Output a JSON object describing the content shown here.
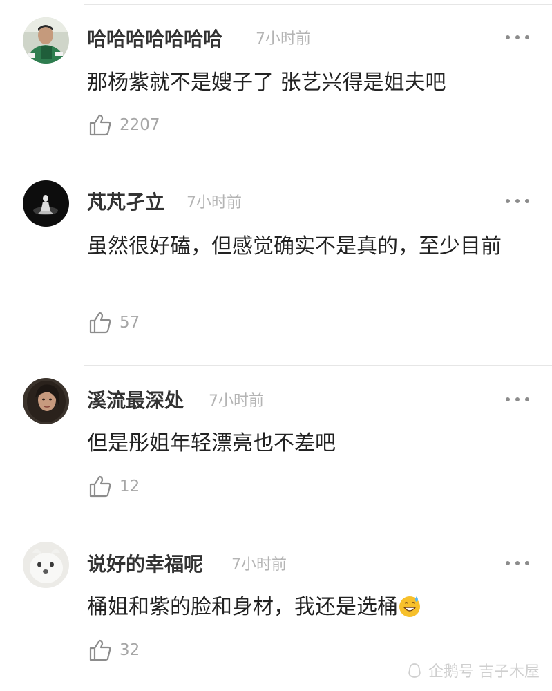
{
  "comments": [
    {
      "username": "哈哈哈哈哈哈哈",
      "time": "7小时前",
      "text": "那杨紫就不是嫂子了 张艺兴得是姐夫吧",
      "likes": "2207"
    },
    {
      "username": "芃芃孑立",
      "time": "7小时前",
      "text": "虽然很好磕，但感觉确实不是真的，至少目前",
      "likes": "57"
    },
    {
      "username": "溪流最深处",
      "time": "7小时前",
      "text": "但是彤姐年轻漂亮也不差吧",
      "likes": "12"
    },
    {
      "username": "说好的幸福呢",
      "time": "7小时前",
      "text": "桶姐和紫的脸和身材，我还是选桶",
      "likes": "32"
    }
  ],
  "icons": {
    "like": "thumbs-up-icon",
    "more": "more-dots-icon",
    "emoji": "grinning-sweat-emoji"
  },
  "watermark": "企鹅号 吉子木屋",
  "colors": {
    "username": "#333333",
    "timestamp": "#b4b4b4",
    "text": "#222222",
    "like_count": "#a6a6a6",
    "divider": "#e6e6e6"
  }
}
